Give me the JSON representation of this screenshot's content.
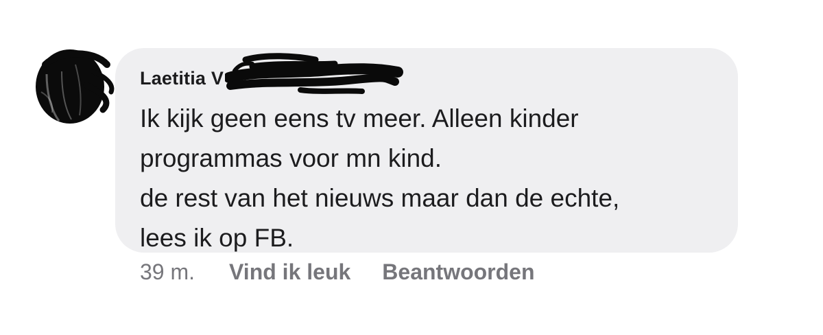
{
  "comment": {
    "author": "Laetitia V",
    "text_lines": [
      "Ik kijk geen eens tv meer. Alleen kinder",
      "programmas voor mn kind.",
      "de rest van het nieuws maar dan de echte,",
      "lees ik op FB."
    ],
    "timestamp": "39 m.",
    "like_label": "Vind ik leuk",
    "reply_label": "Beantwoorden"
  },
  "colors": {
    "bubble_background": "#efeff1",
    "text": "#1c1c1e",
    "secondary_text": "#76767b",
    "redaction": "#0a0a0a"
  },
  "icons": {
    "avatar": "scribbled-out-profile-photo",
    "redaction": "black-marker-scribble"
  }
}
